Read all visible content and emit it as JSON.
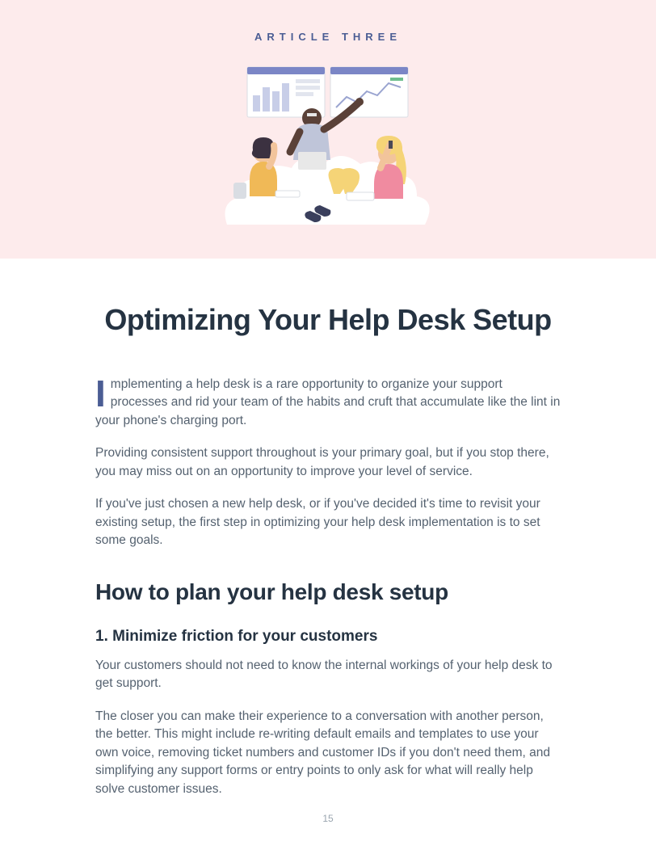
{
  "eyebrow": "ARTICLE THREE",
  "title": "Optimizing Your Help Desk Setup",
  "paragraphs": {
    "intro1": "Implementing a help desk is a rare opportunity to organize your support processes and rid your team of the habits and cruft that accumulate like the lint in your phone's charging port.",
    "intro2": "Providing consistent support throughout is your primary goal, but if you stop there, you may miss out on an opportunity to improve your level of service.",
    "intro3": "If you've just chosen a new help desk, or if you've decided it's time to revisit your existing setup, the first step in optimizing your help desk implementation is to set some goals."
  },
  "section_heading": "How to plan your help desk setup",
  "sub_heading": "1. Minimize friction for your customers",
  "sub_paragraphs": {
    "p1": "Your customers should not need to know the internal workings of your help desk to get support.",
    "p2": "The closer you can make their experience to a conversation with another person, the better. This might include re-writing default emails and templates to use your own voice, removing ticket numbers and customer IDs if you don't need them, and simplifying any support forms or entry points to only ask for what will really help solve customer issues."
  },
  "page_number": "15"
}
